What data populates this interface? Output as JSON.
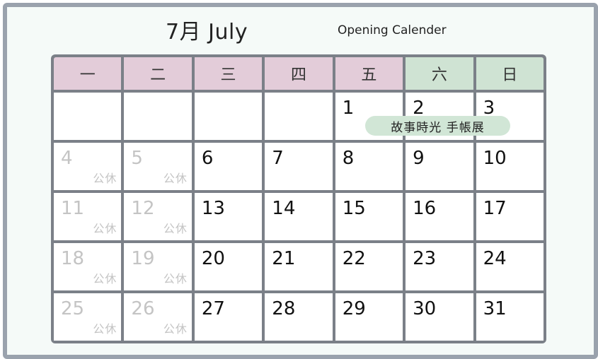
{
  "header": {
    "title": "7月 July",
    "subtitle": "Opening Calender"
  },
  "weekdays": [
    "一",
    "二",
    "三",
    "四",
    "五",
    "六",
    "日"
  ],
  "holiday_label": "公休",
  "event": {
    "label": "故事時光 手帳展"
  },
  "weeks": [
    [
      {
        "day": "",
        "holiday": false
      },
      {
        "day": "",
        "holiday": false
      },
      {
        "day": "",
        "holiday": false
      },
      {
        "day": "",
        "holiday": false
      },
      {
        "day": "1",
        "holiday": false
      },
      {
        "day": "2",
        "holiday": false
      },
      {
        "day": "3",
        "holiday": false
      }
    ],
    [
      {
        "day": "4",
        "holiday": true
      },
      {
        "day": "5",
        "holiday": true
      },
      {
        "day": "6",
        "holiday": false
      },
      {
        "day": "7",
        "holiday": false
      },
      {
        "day": "8",
        "holiday": false
      },
      {
        "day": "9",
        "holiday": false
      },
      {
        "day": "10",
        "holiday": false
      }
    ],
    [
      {
        "day": "11",
        "holiday": true
      },
      {
        "day": "12",
        "holiday": true
      },
      {
        "day": "13",
        "holiday": false
      },
      {
        "day": "14",
        "holiday": false
      },
      {
        "day": "15",
        "holiday": false
      },
      {
        "day": "16",
        "holiday": false
      },
      {
        "day": "17",
        "holiday": false
      }
    ],
    [
      {
        "day": "18",
        "holiday": true
      },
      {
        "day": "19",
        "holiday": true
      },
      {
        "day": "20",
        "holiday": false
      },
      {
        "day": "21",
        "holiday": false
      },
      {
        "day": "22",
        "holiday": false
      },
      {
        "day": "23",
        "holiday": false
      },
      {
        "day": "24",
        "holiday": false
      }
    ],
    [
      {
        "day": "25",
        "holiday": true
      },
      {
        "day": "26",
        "holiday": true
      },
      {
        "day": "27",
        "holiday": false
      },
      {
        "day": "28",
        "holiday": false
      },
      {
        "day": "29",
        "holiday": false
      },
      {
        "day": "30",
        "holiday": false
      },
      {
        "day": "31",
        "holiday": false
      }
    ]
  ],
  "colors": {
    "frame": "#9aa2ad",
    "grid_lines": "#7b8088",
    "weekday_header": "#e3ccd9",
    "weekend_header": "#cfe3d3",
    "event_pill": "#d1e6d6",
    "holiday_text": "#c4c4c4"
  }
}
